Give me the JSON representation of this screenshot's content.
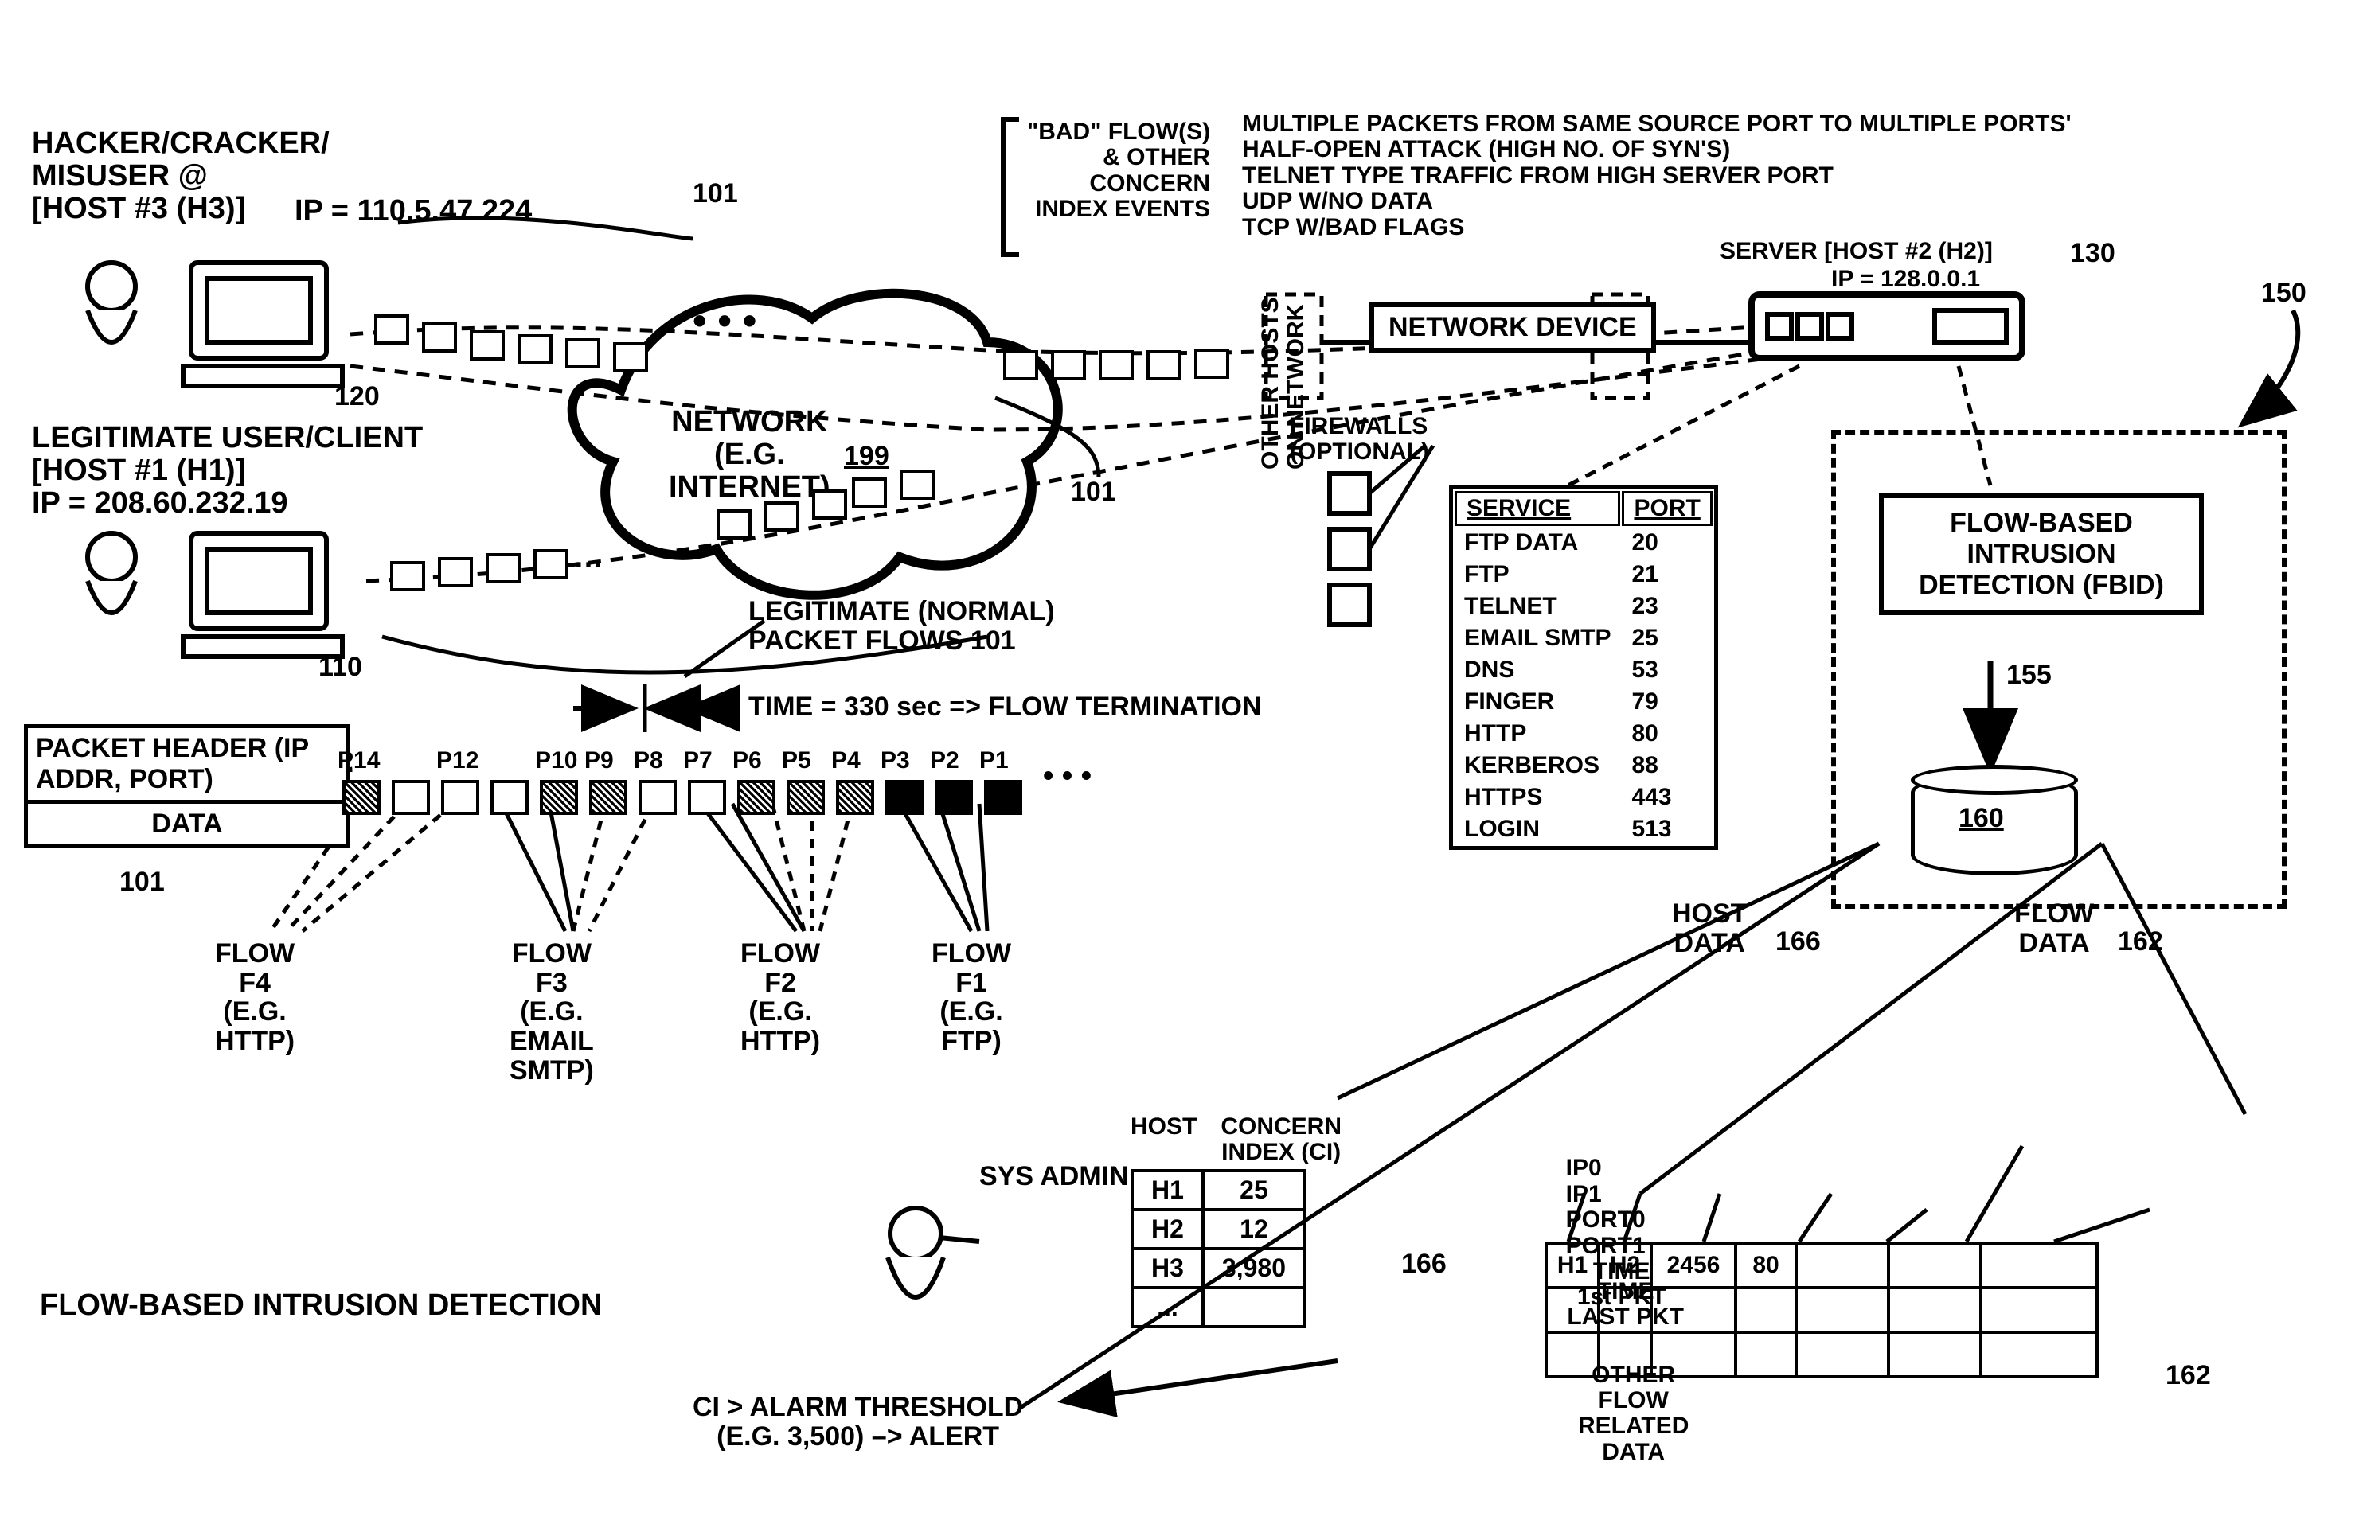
{
  "hacker": {
    "label": "HACKER/CRACKER/\nMISUSER @\n[HOST #3 (H3)]",
    "ip": "IP = 110.5.47.224",
    "ref": "120"
  },
  "legit": {
    "label": "LEGITIMATE USER/CLIENT\n[HOST #1 (H1)]\nIP = 208.60.232.19",
    "ref": "110"
  },
  "packet_ref": "101",
  "network": {
    "label": "NETWORK\n(E.G.\nINTERNET)",
    "ref": "199"
  },
  "legit_flow_label": "LEGITIMATE (NORMAL)\nPACKET FLOWS 101",
  "bad_flows_header": "\"BAD\" FLOW(S)\n& OTHER\nCONCERN\nINDEX EVENTS",
  "bad_flows_list": "MULTIPLE PACKETS FROM SAME SOURCE PORT TO MULTIPLE PORTS'\nHALF-OPEN ATTACK (HIGH NO. OF SYN'S)\nTELNET TYPE TRAFFIC FROM HIGH SERVER PORT\nUDP W/NO DATA\nTCP W/BAD FLAGS",
  "server": {
    "label": "SERVER [HOST #2 (H2)]",
    "ip": "IP = 128.0.0.1",
    "ref": "130"
  },
  "netdev": "NETWORK\nDEVICE",
  "firewalls": "FIREWALLS\n(OPTIONAL)",
  "other_hosts": "OTHER HOSTS\nON NETWORK",
  "fbid": {
    "label": "FLOW-BASED\nINTRUSION\nDETECTION\n(FBID)",
    "box_ref": "150",
    "ref": "155"
  },
  "db_ref": "160",
  "service_table": {
    "headers": [
      "SERVICE",
      "PORT"
    ],
    "rows": [
      [
        "FTP DATA",
        "20"
      ],
      [
        "FTP",
        "21"
      ],
      [
        "TELNET",
        "23"
      ],
      [
        "EMAIL SMTP",
        "25"
      ],
      [
        "DNS",
        "53"
      ],
      [
        "FINGER",
        "79"
      ],
      [
        "HTTP",
        "80"
      ],
      [
        "KERBEROS",
        "88"
      ],
      [
        "HTTPS",
        "443"
      ],
      [
        "LOGIN",
        "513"
      ]
    ]
  },
  "packet_header": {
    "title": "PACKET HEADER\n(IP ADDR, PORT)",
    "data": "DATA",
    "ref": "101"
  },
  "flow_term": "TIME = 330 sec => FLOW TERMINATION",
  "packets": [
    "P14",
    "",
    "P12",
    "",
    "P10",
    "P9",
    "P8",
    "P7",
    "P6",
    "P5",
    "P4",
    "P3",
    "P2",
    "P1"
  ],
  "flows": {
    "f4": "FLOW\nF4\n(E.G.\nHTTP)",
    "f3": "FLOW\nF3\n(E.G.\nEMAIL\nSMTP)",
    "f2": "FLOW\nF2\n(E.G.\nHTTP)",
    "f1": "FLOW\nF1\n(E.G.\nFTP)"
  },
  "title": "FLOW-BASED INTRUSION DETECTION",
  "sysadmin": "SYS ADMIN",
  "alert": "CI > ALARM THRESHOLD\n(E.G. 3,500) –> ALERT",
  "host_table": {
    "headers": [
      "HOST",
      "CONCERN\nINDEX (CI)"
    ],
    "rows": [
      [
        "H1",
        "25"
      ],
      [
        "H2",
        "12"
      ],
      [
        "H3",
        "3,980"
      ],
      [
        "...",
        ""
      ]
    ],
    "ref": "166"
  },
  "host_data_label": "HOST\nDATA",
  "host_data_ref": "166",
  "flow_data_label": "FLOW\nDATA",
  "flow_data_ref": "162",
  "flow_table": {
    "headers": [
      "IP0",
      "IP1",
      "PORT0",
      "PORT1",
      "TIME\n1st PKT",
      "TIME\nLAST PKT",
      "OTHER\nFLOW\nRELATED\nDATA"
    ],
    "rows": [
      [
        "H1",
        "H2",
        "2456",
        "80",
        "",
        "",
        ""
      ],
      [
        "",
        "",
        "",
        "",
        "",
        "",
        ""
      ],
      [
        "",
        "",
        "",
        "",
        "",
        "",
        ""
      ]
    ],
    "ref": "162"
  }
}
